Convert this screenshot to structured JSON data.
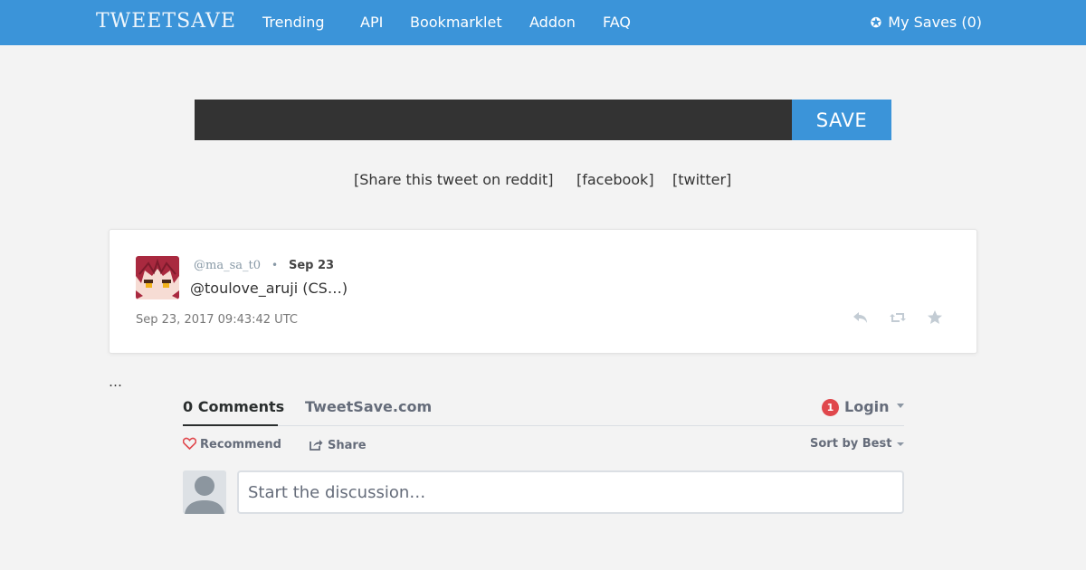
{
  "nav": {
    "logo": "TWEETSAVE",
    "links": [
      "Trending",
      "API",
      "Bookmarklet",
      "Addon",
      "FAQ"
    ],
    "my_saves_icon": "star-circle-icon",
    "my_saves_label": "My Saves (0)"
  },
  "save_form": {
    "input_value": "",
    "button_label": "SAVE"
  },
  "share": {
    "reddit": "[Share this tweet on reddit]",
    "facebook": "[facebook]",
    "twitter": "[twitter]"
  },
  "tweet": {
    "handle": "@ma_sa_t0",
    "separator": "•",
    "date_short": "Sep 23",
    "text": "@toulove_aruji (CS…)",
    "timestamp": "Sep 23, 2017 09:43:42 UTC",
    "actions": [
      "reply-icon",
      "retweet-icon",
      "favorite-icon"
    ]
  },
  "ellipsis": "…",
  "comments": {
    "count_label": "0 Comments",
    "site_label": "TweetSave.com",
    "notification_count": "1",
    "login_label": "Login",
    "recommend_label": "Recommend",
    "share_label": "Share",
    "sort_label": "Sort by Best",
    "input_placeholder": "Start the discussion…"
  },
  "colors": {
    "brand_blue": "#3b94d9",
    "input_dark": "#333333",
    "badge_red": "#e0474c",
    "page_background": "#f3f3f3"
  }
}
